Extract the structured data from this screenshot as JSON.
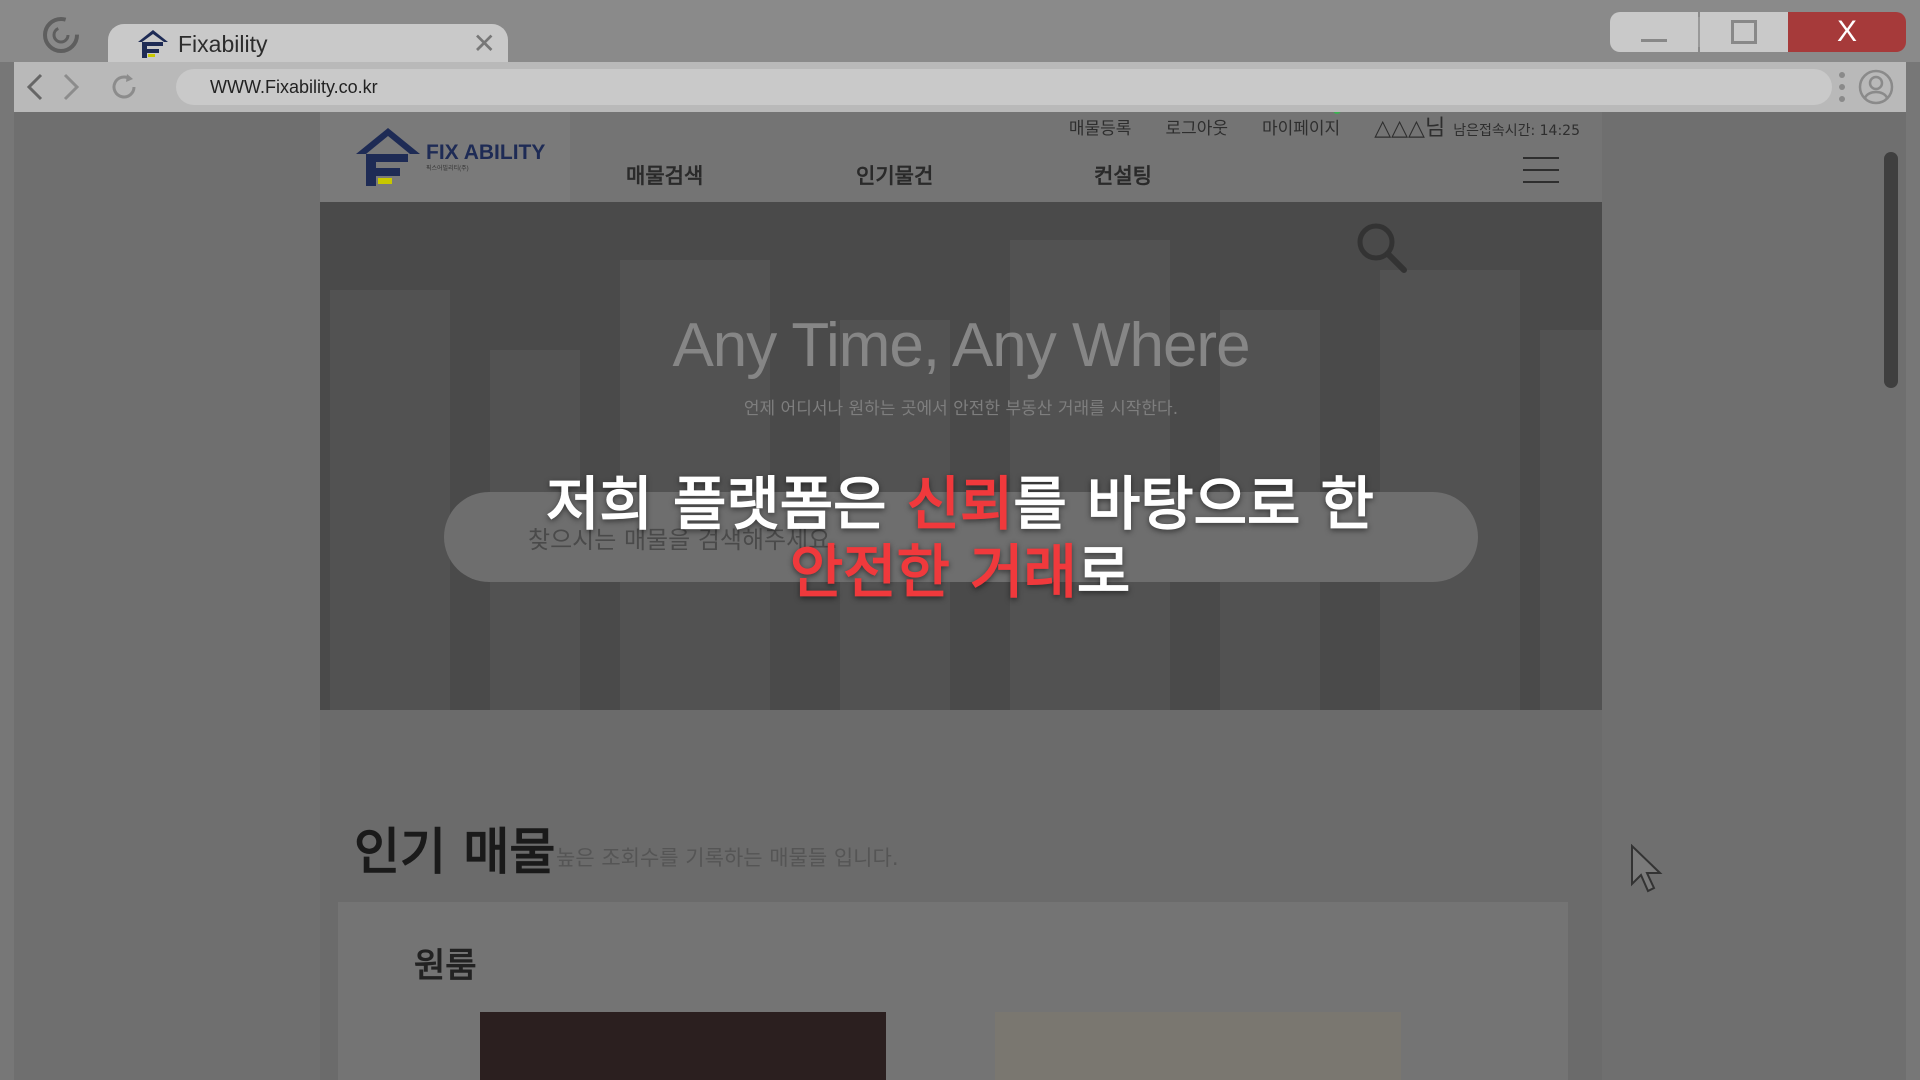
{
  "browser": {
    "tab_title": "Fixability",
    "tab_close": "✕",
    "url": "WWW.Fixability.co.kr",
    "close_label": "X"
  },
  "site": {
    "logo_text": "FIX ABILITY",
    "logo_sub": "픽스어빌리티(주)",
    "top_links": [
      "매물등록",
      "로그아웃",
      "마이페이지"
    ],
    "user_name": "△△△님",
    "session_timer": "남은접속시간: 14:25",
    "nav": [
      "매물검색",
      "인기물건",
      "컨설팅"
    ],
    "hero_title": "Any Time, Any Where",
    "hero_subtitle": "언제 어디서나 원하는 곳에서 안전한 부동산 거래를 시작한다.",
    "search_placeholder": "찾으시는 매물을 검색해주세요.",
    "popular_title": "인기 매물",
    "popular_subtitle": "높은 조회수를 기록하는 매물들 입니다.",
    "category": "원룸"
  },
  "caption": {
    "line1_a": "저희 플랫폼은 ",
    "line1_red": "신뢰",
    "line1_b": "를 바탕으로 한",
    "line2_red": "안전한 거래",
    "line2_b": "로"
  },
  "colors": {
    "accent_red": "#f0393c",
    "logo_navy": "#1e2b55",
    "window_close": "#a63a3a"
  }
}
